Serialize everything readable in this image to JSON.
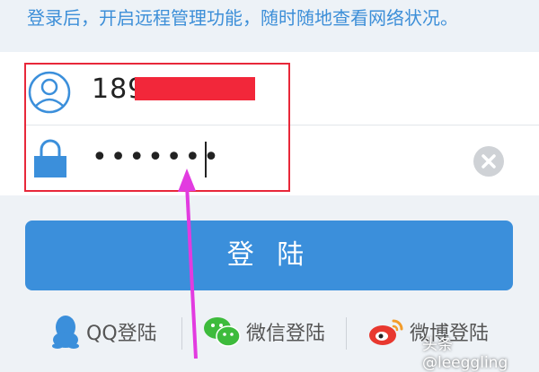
{
  "hint": "登录后，开启远程管理功能，随时随地查看网络状况。",
  "form": {
    "phone_value": "189",
    "password_value": "•••••••"
  },
  "login": {
    "label": "登 陆"
  },
  "social": {
    "qq": "QQ登陆",
    "wechat": "微信登陆",
    "weibo": "微博登陆"
  },
  "watermark": "头条 @leeggling",
  "colors": {
    "accent": "#3b8fdb",
    "hint_text": "#3d8fd8",
    "highlight": "#e8283a",
    "arrow": "#e23be0"
  }
}
